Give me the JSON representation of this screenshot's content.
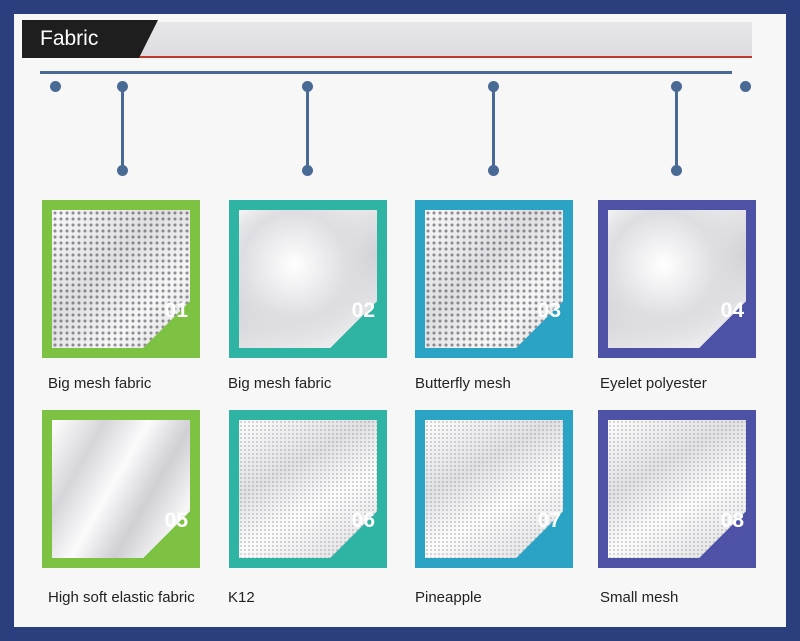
{
  "header": {
    "title": "Fabric"
  },
  "colors": {
    "frame": "#2b3f7e",
    "timeline": "#4a6a96",
    "green": "#7dc242",
    "teal": "#2fb3a3",
    "cyan": "#2aa3c4",
    "purple": "#4e52a6"
  },
  "items": [
    {
      "number": "01",
      "label": "Big mesh fabric",
      "color": "#7dc242",
      "texture": "tex-mesh"
    },
    {
      "number": "02",
      "label": "Big mesh fabric",
      "color": "#2fb3a3",
      "texture": "tex-folds"
    },
    {
      "number": "03",
      "label": "Butterfly mesh",
      "color": "#2aa3c4",
      "texture": "tex-mesh"
    },
    {
      "number": "04",
      "label": "Eyelet polyester",
      "color": "#4e52a6",
      "texture": "tex-folds"
    },
    {
      "number": "05",
      "label": "High soft elastic fabric",
      "color": "#7dc242",
      "texture": "tex-smooth"
    },
    {
      "number": "06",
      "label": "K12",
      "color": "#2fb3a3",
      "texture": "tex-fine"
    },
    {
      "number": "07",
      "label": "Pineapple",
      "color": "#2aa3c4",
      "texture": "tex-fine"
    },
    {
      "number": "08",
      "label": "Small mesh",
      "color": "#4e52a6",
      "texture": "tex-fine"
    }
  ]
}
